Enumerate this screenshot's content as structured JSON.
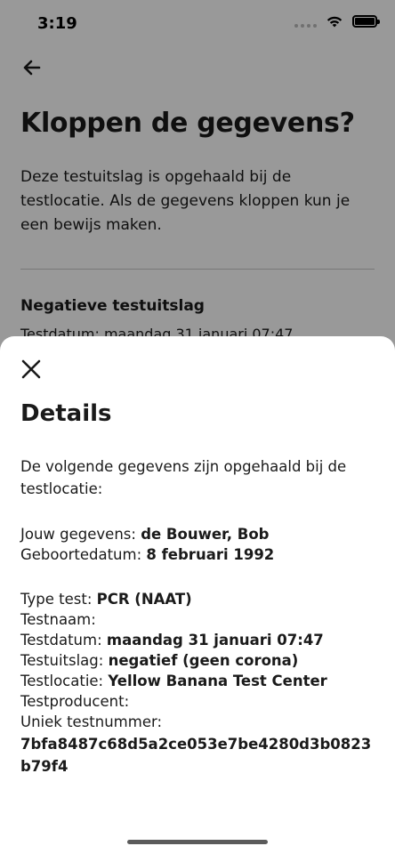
{
  "status_bar": {
    "time": "3:19"
  },
  "background": {
    "title": "Kloppen de gegevens?",
    "body": "Deze testuitslag is opgehaald bij de testlocatie. Als de gegevens kloppen kun je een bewijs maken.",
    "result_title": "Negatieve testuitslag",
    "result_date": "Testdatum: maandag 31 januari 07:47"
  },
  "sheet": {
    "title": "Details",
    "intro": "De volgende gegevens zijn opgehaald bij de testlocatie:",
    "personal": [
      {
        "label": "Jouw gegevens: ",
        "value": "de Bouwer, Bob"
      },
      {
        "label": "Geboortedatum: ",
        "value": "8 februari 1992"
      }
    ],
    "test": [
      {
        "label": "Type test: ",
        "value": "PCR (NAAT)"
      },
      {
        "label": "Testnaam: ",
        "value": ""
      },
      {
        "label": "Testdatum: ",
        "value": "maandag 31 januari 07:47"
      },
      {
        "label": "Testuitslag: ",
        "value": "negatief (geen corona)"
      },
      {
        "label": "Testlocatie: ",
        "value": "Yellow Banana Test Center"
      },
      {
        "label": "Testproducent: ",
        "value": ""
      },
      {
        "label": "Uniek testnummer:",
        "value": ""
      }
    ],
    "test_number": "7bfa8487c68d5a2ce053e7be4280d3b0823b79f4"
  },
  "colors": {
    "overlay": "#000000",
    "text": "#1a1a1a",
    "divider": "#c9c9c9"
  }
}
